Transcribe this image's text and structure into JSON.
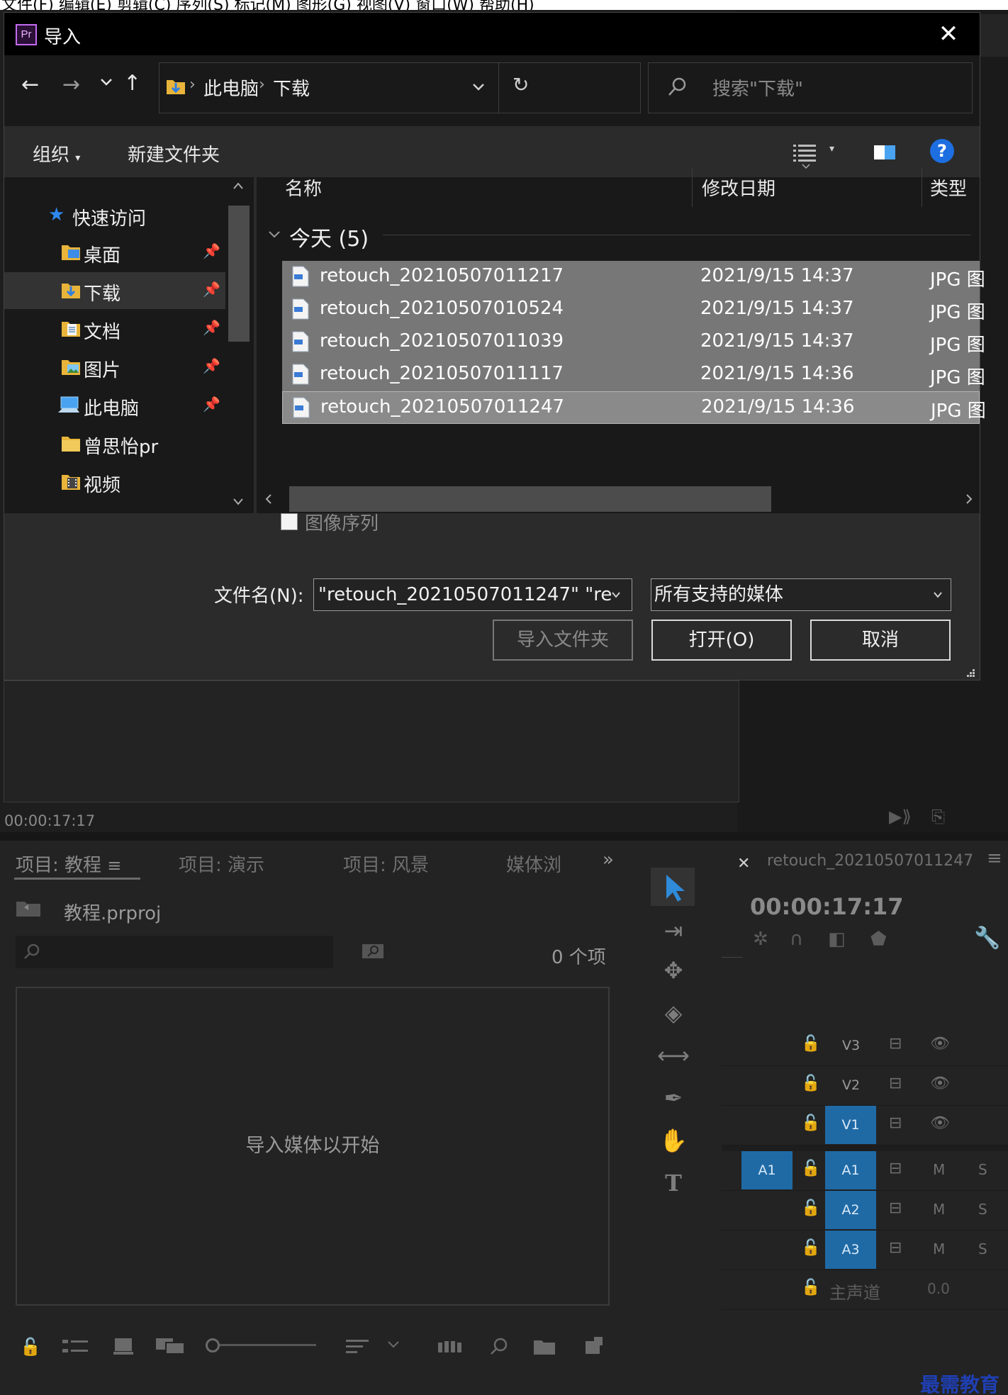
{
  "menubar": {
    "text": "文件(F)  编辑(E)  剪辑(C)  序列(S)  标记(M)  图形(G)  视图(V)  窗口(W)  帮助(H)"
  },
  "dialog": {
    "title": "导入",
    "app_icon": "Pr",
    "close_label": "✕",
    "breadcrumb": [
      "此电脑",
      "下载"
    ],
    "search_placeholder": "搜索\"下载\"",
    "toolbar": {
      "organize": "组织",
      "new_folder": "新建文件夹",
      "help": "?"
    },
    "nav_tree": {
      "quick_access": "快速访问",
      "items": [
        {
          "label": "桌面",
          "pinned": true
        },
        {
          "label": "下载",
          "pinned": true,
          "selected": true
        },
        {
          "label": "文档",
          "pinned": true
        },
        {
          "label": "图片",
          "pinned": true
        },
        {
          "label": "此电脑",
          "pinned": true
        },
        {
          "label": "曾思怡pr",
          "pinned": false
        },
        {
          "label": "视频",
          "pinned": false
        }
      ]
    },
    "columns": {
      "name": "名称",
      "modified": "修改日期",
      "type": "类型"
    },
    "group_label": "今天 (5)",
    "files": [
      {
        "name": "retouch_20210507011217",
        "modified": "2021/9/15 14:37",
        "type": "JPG 图"
      },
      {
        "name": "retouch_20210507010524",
        "modified": "2021/9/15 14:37",
        "type": "JPG 图"
      },
      {
        "name": "retouch_20210507011039",
        "modified": "2021/9/15 14:37",
        "type": "JPG 图"
      },
      {
        "name": "retouch_20210507011117",
        "modified": "2021/9/15 14:36",
        "type": "JPG 图"
      },
      {
        "name": "retouch_20210507011247",
        "modified": "2021/9/15 14:36",
        "type": "JPG 图"
      }
    ],
    "image_sequence_label": "图像序列",
    "filename_label": "文件名(N):",
    "filename_value": "\"retouch_20210507011247\" \"re",
    "filter_value": "所有支持的媒体",
    "buttons": {
      "import_folder": "导入文件夹",
      "open": "打开(O)",
      "cancel": "取消"
    }
  },
  "preview": {
    "timecode": "00:00:17:17"
  },
  "project_panel": {
    "tabs": [
      "项目: 教程",
      "项目: 演示",
      "项目: 风景",
      "媒体浏"
    ],
    "project_file": "教程.prproj",
    "item_count": "0 个项",
    "empty_message": "导入媒体以开始"
  },
  "timeline": {
    "sequence_name": "retouch_20210507011247",
    "timecode": "00:00:17:17",
    "video_tracks": [
      "V3",
      "V2",
      "V1"
    ],
    "audio_tracks": [
      "A1",
      "A2",
      "A3"
    ],
    "source_patch": "A1",
    "mute_label": "M",
    "solo_label": "S",
    "master_label": "主声道",
    "master_value": "0.0"
  },
  "watermark": "最需教育",
  "colors": {
    "accent_blue": "#1f6aa5",
    "selection": "#777777",
    "premiere_purple": "#c46bf0"
  }
}
